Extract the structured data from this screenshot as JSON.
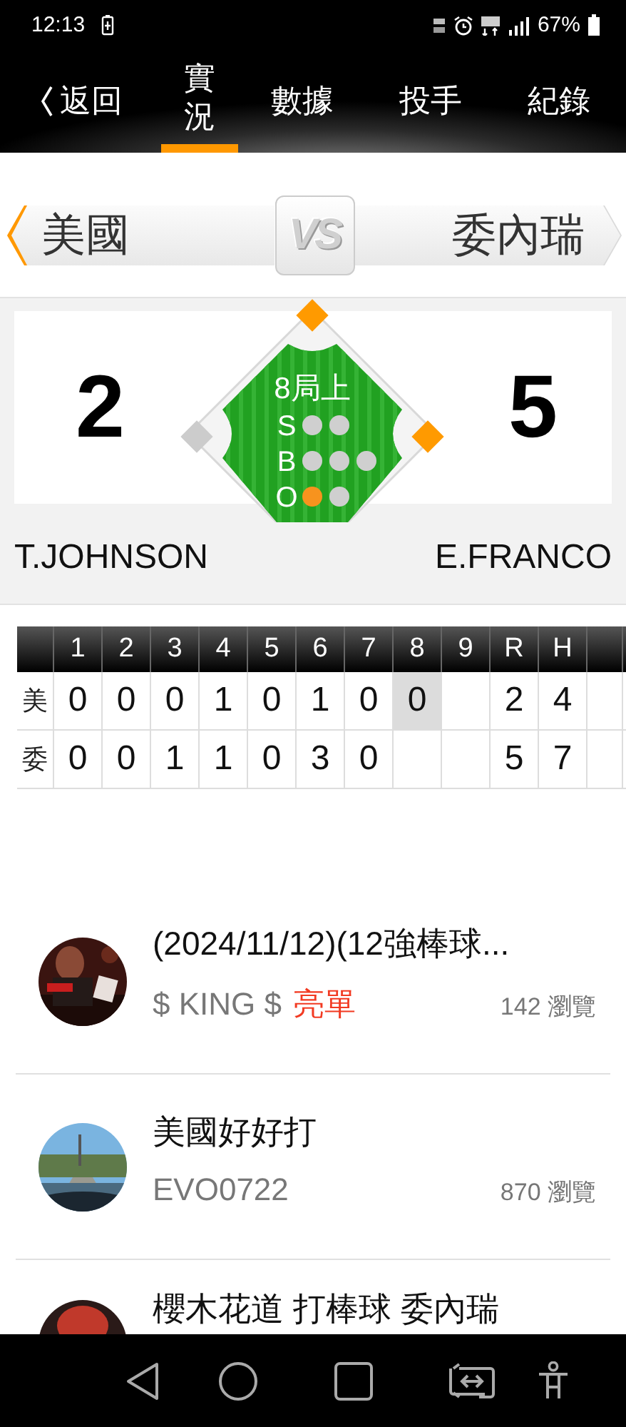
{
  "status_bar": {
    "time": "12:13",
    "battery": "67%"
  },
  "header": {
    "back": "返回",
    "tabs": [
      {
        "label": "實況",
        "selected": true
      },
      {
        "label": "數據",
        "selected": false
      },
      {
        "label": "投手",
        "selected": false
      },
      {
        "label": "紀錄",
        "selected": false
      }
    ]
  },
  "matchup": {
    "away": "美國",
    "vs": "VS",
    "home": "委內瑞"
  },
  "scoreboard": {
    "away_score": "2",
    "home_score": "5",
    "inning": "8局上",
    "counts": [
      {
        "label": "S",
        "lights": [
          {
            "on": false
          },
          {
            "on": false
          }
        ]
      },
      {
        "label": "B",
        "lights": [
          {
            "on": false
          },
          {
            "on": false
          },
          {
            "on": false
          }
        ]
      },
      {
        "label": "O",
        "lights": [
          {
            "on": true
          },
          {
            "on": false
          }
        ]
      }
    ],
    "bases": {
      "first": true,
      "second": true,
      "third": false
    },
    "away_pitcher": "T.JOHNSON",
    "home_pitcher": "E.FRANCO"
  },
  "linescore": {
    "columns": [
      "1",
      "2",
      "3",
      "4",
      "5",
      "6",
      "7",
      "8",
      "9",
      "R",
      "H"
    ],
    "rows": [
      {
        "team": "美",
        "innings": [
          {
            "text": "0",
            "selected": false
          },
          {
            "text": "0",
            "selected": false
          },
          {
            "text": "0",
            "selected": false
          },
          {
            "text": "1",
            "selected": false
          },
          {
            "text": "0",
            "selected": false
          },
          {
            "text": "1",
            "selected": false
          },
          {
            "text": "0",
            "selected": false
          },
          {
            "text": "0",
            "selected": true
          }
        ],
        "runs": "2",
        "hits": "4"
      },
      {
        "team": "委",
        "innings": [
          {
            "text": "0",
            "selected": false
          },
          {
            "text": "0",
            "selected": false
          },
          {
            "text": "1",
            "selected": false
          },
          {
            "text": "1",
            "selected": false
          },
          {
            "text": "0",
            "selected": false
          },
          {
            "text": "3",
            "selected": false
          },
          {
            "text": "0",
            "selected": false
          }
        ],
        "runs": "5",
        "hits": "7"
      }
    ]
  },
  "posts": [
    {
      "title": "(2024/11/12)(12強棒球...",
      "author": "$ KING $",
      "tag": "亮單",
      "views": "142 瀏覽"
    },
    {
      "title": "美國好好打",
      "author": "EVO0722",
      "views": "870 瀏覽"
    },
    {
      "title": "櫻木花道 打棒球 委內瑞"
    }
  ]
}
